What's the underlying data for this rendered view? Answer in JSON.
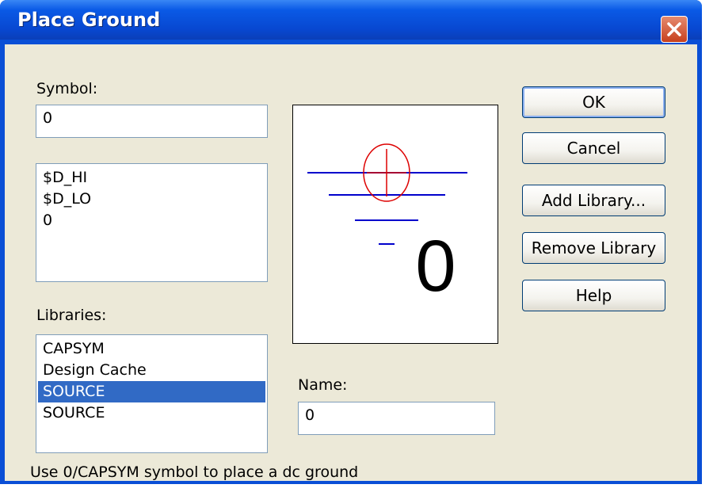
{
  "window": {
    "title": "Place Ground"
  },
  "symbol": {
    "label": "Symbol:",
    "value": "0"
  },
  "symbols_list": [
    "$D_HI",
    "$D_LO",
    "0"
  ],
  "libraries": {
    "label": "Libraries:",
    "items": [
      "CAPSYM",
      "Design Cache",
      "SOURCE",
      "SOURCE"
    ],
    "selected_index": 2
  },
  "preview": {
    "text": "0"
  },
  "name": {
    "label": "Name:",
    "value": "0"
  },
  "buttons": {
    "ok": "OK",
    "cancel": "Cancel",
    "add_library": "Add Library...",
    "remove_library": "Remove Library",
    "help": "Help"
  },
  "status": "Use 0/CAPSYM symbol to place a dc ground",
  "colors": {
    "titlebar": "#0a5ae6",
    "selection": "#316ac5",
    "dialog_bg": "#ece9d8",
    "preview_line": "#0000cc",
    "preview_circle": "#dd0000"
  }
}
